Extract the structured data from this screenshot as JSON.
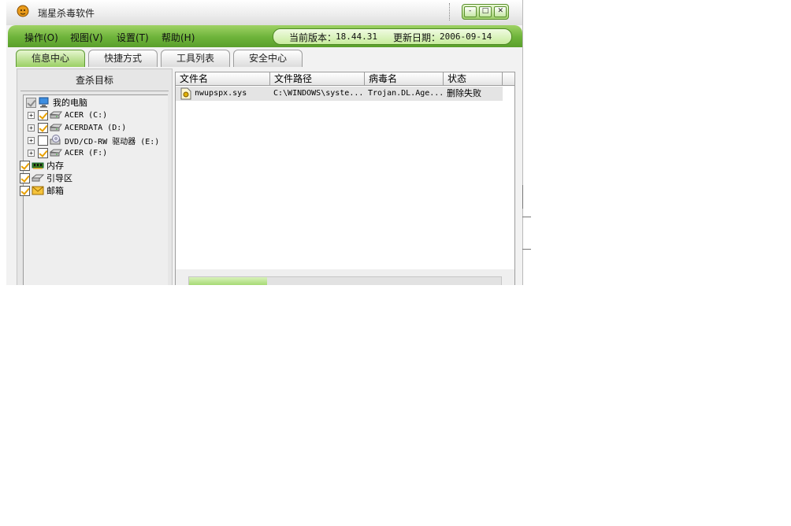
{
  "window": {
    "title": "瑞星杀毒软件",
    "controls": {
      "minimize": "-",
      "maximize": "□",
      "close": "✕"
    }
  },
  "menu": [
    {
      "label": "操作(O)"
    },
    {
      "label": "视图(V)"
    },
    {
      "label": "设置(T)"
    },
    {
      "label": "帮助(H)"
    }
  ],
  "version": {
    "version_label": "当前版本：",
    "version_value": "18.44.31",
    "date_label": "更新日期：",
    "date_value": "2006-09-14"
  },
  "tabs": [
    {
      "label": "信息中心",
      "active": true
    },
    {
      "label": "快捷方式",
      "active": false
    },
    {
      "label": "工具列表",
      "active": false
    },
    {
      "label": "安全中心",
      "active": false
    }
  ],
  "targets": {
    "title": "查杀目标",
    "root": {
      "label": "我的电脑",
      "icon": "computer-icon",
      "checked": "partial"
    },
    "drives": [
      {
        "label": "ACER (C:)",
        "icon": "hard-drive-icon",
        "checked": true
      },
      {
        "label": "ACERDATA (D:)",
        "icon": "hard-drive-icon",
        "checked": true
      },
      {
        "label": "DVD/CD-RW 驱动器 (E:)",
        "icon": "cd-drive-icon",
        "checked": false
      },
      {
        "label": "ACER (F:)",
        "icon": "hard-drive-icon",
        "checked": true
      }
    ],
    "others": [
      {
        "label": "内存",
        "icon": "memory-icon",
        "checked": true
      },
      {
        "label": "引导区",
        "icon": "boot-sector-icon",
        "checked": true
      },
      {
        "label": "邮箱",
        "icon": "mailbox-icon",
        "checked": true
      }
    ]
  },
  "results": {
    "columns": [
      "文件名",
      "文件路径",
      "病毒名",
      "状态"
    ],
    "rows": [
      {
        "file": "nwupspx.sys",
        "path": "C:\\WINDOWS\\syste...",
        "virus": "Trojan.DL.Age...",
        "status": "删除失败",
        "icon": "system-file-icon"
      }
    ]
  },
  "progress": {
    "fraction": 0.25
  },
  "colors": {
    "accent_green": "#6db33a",
    "tab_active": "#9bd064"
  }
}
